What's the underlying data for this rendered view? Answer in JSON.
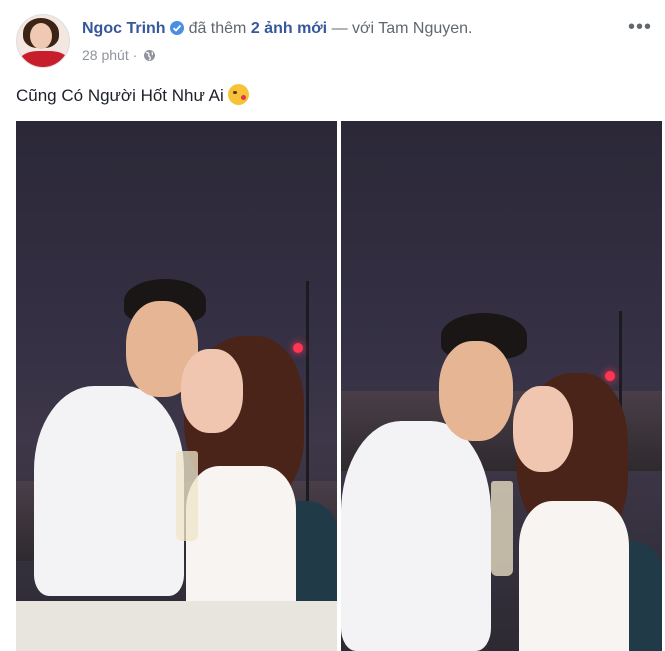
{
  "post": {
    "author": "Ngoc Trinh",
    "action": "đã thêm",
    "photo_count_text": "2 ảnh mới",
    "with_text": "— với",
    "tagged_user": "Tam Nguyen.",
    "time": "28 phút",
    "dot": "·",
    "more_label": "•••",
    "caption": "Cũng Có Người Hốt Như Ai"
  },
  "icons": {
    "verified": "verified-badge-icon",
    "globe": "globe-icon",
    "emoji": "kissing-face-emoji"
  },
  "colors": {
    "author": "#365899",
    "verified": "#4a90e2",
    "meta": "#90949c"
  }
}
